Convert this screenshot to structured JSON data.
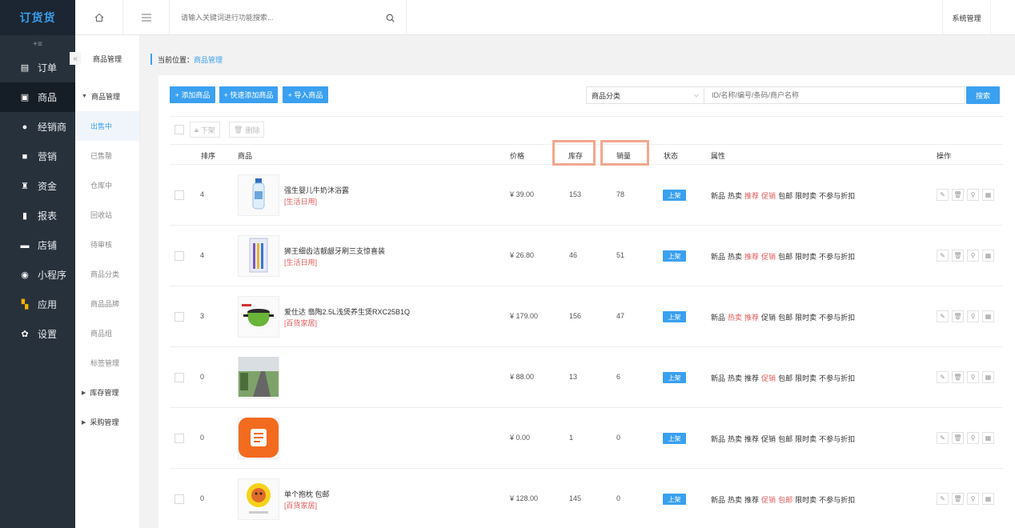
{
  "app": {
    "logo": "订货货"
  },
  "nav": {
    "collapse": "+≡",
    "items": [
      {
        "label": "订单",
        "icon": "document-icon"
      },
      {
        "label": "商品",
        "icon": "product-icon"
      },
      {
        "label": "经销商",
        "icon": "user-icon"
      },
      {
        "label": "营销",
        "icon": "gift-icon"
      },
      {
        "label": "资金",
        "icon": "money-bag-icon"
      },
      {
        "label": "报表",
        "icon": "bar-chart-icon"
      },
      {
        "label": "店铺",
        "icon": "store-icon"
      },
      {
        "label": "小程序",
        "icon": "mini-program-icon"
      },
      {
        "label": "应用",
        "icon": "apps-icon"
      },
      {
        "label": "设置",
        "icon": "gear-icon"
      }
    ]
  },
  "topbar": {
    "search_placeholder": "请输入关键词进行功能搜索...",
    "system": "系统管理"
  },
  "subnav": {
    "title": "商品管理",
    "collapse_arrow": "«",
    "items": [
      {
        "label": "商品管理"
      },
      {
        "label": "出售中"
      },
      {
        "label": "已售罄"
      },
      {
        "label": "仓库中"
      },
      {
        "label": "回收站"
      },
      {
        "label": "待审核"
      },
      {
        "label": "商品分类"
      },
      {
        "label": "商品品牌"
      },
      {
        "label": "商品组"
      },
      {
        "label": "标签管理"
      },
      {
        "label": "库存管理"
      },
      {
        "label": "采购管理"
      }
    ]
  },
  "breadcrumb": {
    "prefix": "当前位置：",
    "current": "商品管理"
  },
  "toolbar": {
    "add": "+ 添加商品",
    "quick_add": "+ 快速添加商品",
    "import": "+ 导入商品",
    "category_select": "商品分类",
    "filter_placeholder": "ID/名称/编号/条码/商户名称",
    "search": "搜索"
  },
  "bulk": {
    "offshelf": "下架",
    "delete": "删除"
  },
  "table": {
    "headers": {
      "sort": "排序",
      "product": "商品",
      "price": "价格",
      "stock": "库存",
      "sales": "销量",
      "status": "状态",
      "attrs": "属性",
      "ops": "操作"
    },
    "attr_labels": [
      "新品",
      "热卖",
      "推荐",
      "促销",
      "包邮",
      "限时卖",
      "不参与折扣"
    ],
    "rows": [
      {
        "sort": "4",
        "name": "强生婴儿牛奶沐浴露",
        "category": "[生活日用]",
        "price": "¥ 39.00",
        "stock": "153",
        "sales": "78",
        "status": "上架",
        "thumb_icon": "bottle-icon",
        "active_attrs": [
          2,
          3
        ]
      },
      {
        "sort": "4",
        "name": "狮王细齿洁靓龈牙刷三支惊喜装",
        "category": "[生活日用]",
        "price": "¥ 26.80",
        "stock": "46",
        "sales": "51",
        "status": "上架",
        "thumb_icon": "toothbrush-pack-icon",
        "active_attrs": [
          2,
          3
        ]
      },
      {
        "sort": "3",
        "name": "爱仕达 翡陶2.5L浅煲养生煲RXC25B1Q",
        "category": "[百货家居]",
        "price": "¥ 179.00",
        "stock": "156",
        "sales": "47",
        "status": "上架",
        "thumb_icon": "pot-icon",
        "active_attrs": [
          1,
          2
        ]
      },
      {
        "sort": "0",
        "name": "",
        "category": "",
        "price": "¥ 88.00",
        "stock": "13",
        "sales": "6",
        "status": "上架",
        "thumb_icon": "road-photo-icon",
        "active_attrs": [
          3
        ]
      },
      {
        "sort": "0",
        "name": "",
        "category": "",
        "price": "¥ 0.00",
        "stock": "1",
        "sales": "0",
        "status": "上架",
        "thumb_icon": "orange-doc-app-icon",
        "active_attrs": []
      },
      {
        "sort": "0",
        "name": "单个抱枕 包邮",
        "category": "[百货家居]",
        "price": "¥ 128.00",
        "stock": "145",
        "sales": "0",
        "status": "上架",
        "thumb_icon": "pillow-icon",
        "active_attrs": [
          3,
          4
        ]
      }
    ]
  },
  "colors": {
    "accent": "#3aa0f0",
    "sidebar": "#27313c",
    "highlight": "#f1a88f",
    "tag_red": "#e05a5a"
  }
}
